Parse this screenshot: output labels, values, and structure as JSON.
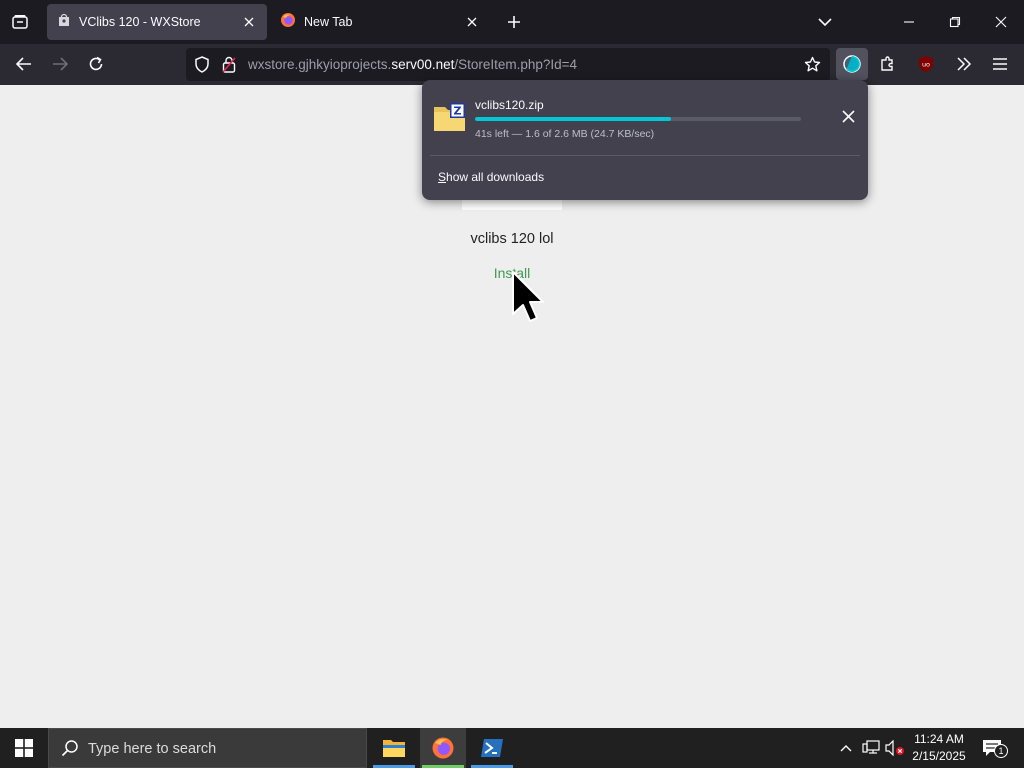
{
  "browser": {
    "tabs": [
      {
        "title": "VClibs 120 - WXStore",
        "active": true
      },
      {
        "title": "New Tab",
        "active": false
      }
    ],
    "url": {
      "prefix": "wxstore.gjhkyioprojects.",
      "domain": "serv00.net",
      "path": "/StoreItem.php?Id=4"
    }
  },
  "page": {
    "app_name": "vclibs 120 lol",
    "install_label": "Install"
  },
  "downloads": {
    "filename": "vclibs120.zip",
    "status": "41s left — 1.6 of 2.6 MB (24.7 KB/sec)",
    "progress": 0.6,
    "show_all_label": "Show all downloads"
  },
  "taskbar": {
    "search_placeholder": "Type here to search",
    "time": "11:24 AM",
    "date": "2/15/2025",
    "notification_count": "1"
  },
  "colors": {
    "progress_fill": "#00c8d7",
    "install_link": "#3f9a53",
    "firefox_active_underline": "#6fcf65",
    "app_underline": "#4c9be8"
  }
}
